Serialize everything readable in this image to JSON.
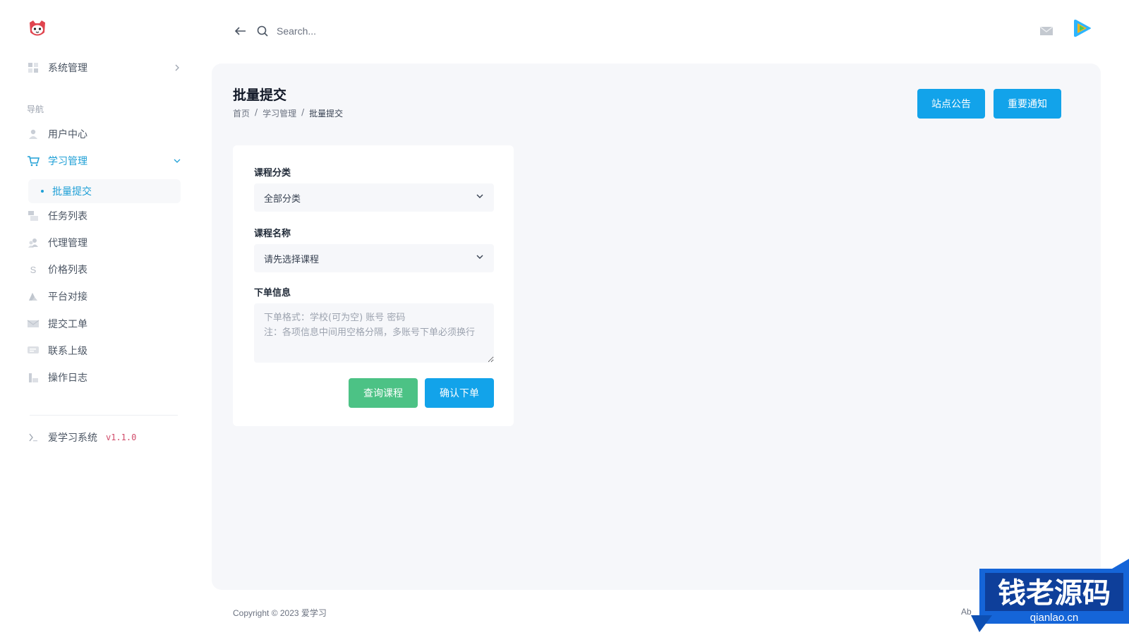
{
  "sidebar": {
    "system": {
      "label": "系统管理"
    },
    "nav_heading": "导航",
    "items": [
      {
        "label": "用户中心",
        "icon": "user-icon"
      },
      {
        "label": "学习管理",
        "icon": "cart-icon"
      },
      {
        "label": "任务列表",
        "icon": "list-icon"
      },
      {
        "label": "代理管理",
        "icon": "agents-icon"
      },
      {
        "label": "价格列表",
        "icon": "dollar-icon"
      },
      {
        "label": "平台对接",
        "icon": "platform-icon"
      },
      {
        "label": "提交工单",
        "icon": "mail-icon"
      },
      {
        "label": "联系上级",
        "icon": "chat-icon"
      },
      {
        "label": "操作日志",
        "icon": "chart-icon"
      }
    ],
    "sub_item": {
      "label": "批量提交"
    },
    "app_name": "爱学习系统",
    "version": "v1.1.0"
  },
  "header": {
    "search_placeholder": "Search..."
  },
  "main": {
    "page_title": "批量提交",
    "breadcrumb": [
      "首页",
      "学习管理",
      "批量提交"
    ],
    "breadcrumb_sep": "/",
    "notice_button": "站点公告",
    "important_button": "重要通知",
    "form": {
      "category_label": "课程分类",
      "category_value": "全部分类",
      "course_label": "课程名称",
      "course_value": "请先选择课程",
      "order_label": "下单信息",
      "order_placeholder": "下单格式：学校(可为空) 账号 密码\n注：各项信息中间用空格分隔，多账号下单必须换行",
      "query_button": "查询课程",
      "confirm_button": "确认下单"
    }
  },
  "footer": {
    "copyright": "Copyright © 2023 爱学习",
    "right_text": "Ab"
  },
  "watermark": {
    "brand": "钱老源码",
    "domain": "qianlao.cn"
  },
  "colors": {
    "accent": "#1e9fd6",
    "primary_button": "#12a3ea",
    "success_button": "#4cc285",
    "panel_bg": "#f6f7fa"
  }
}
